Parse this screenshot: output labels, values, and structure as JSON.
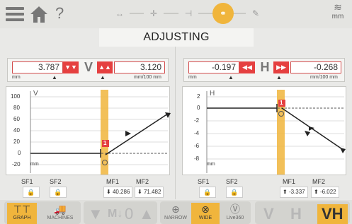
{
  "header": {
    "title": "ADJUSTING",
    "help": "?",
    "unit": "mm",
    "steps": [
      {
        "name": "measure-step-icon",
        "glyph": "↔"
      },
      {
        "name": "center-step-icon",
        "glyph": "✛"
      },
      {
        "name": "shim-step-icon",
        "glyph": "⊣"
      },
      {
        "name": "adjust-step-icon",
        "glyph": "⚭"
      },
      {
        "name": "report-step-icon",
        "glyph": "✎"
      }
    ]
  },
  "vertical": {
    "axis": "V",
    "offset": "3.787",
    "offset_unit": "mm",
    "angle": "3.120",
    "angle_unit": "mm/100 mm",
    "graph_label": "V",
    "y_ticks": [
      "100",
      "80",
      "60",
      "40",
      "20",
      "0",
      "-20"
    ],
    "unit_label": "mm",
    "coupling_marker": "1",
    "sf1": "SF1",
    "sf2": "SF2",
    "mf1_label": "MF1",
    "mf2_label": "MF2",
    "mf1": "40.286",
    "mf2": "71.482"
  },
  "horizontal": {
    "axis": "H",
    "offset": "-0.197",
    "offset_unit": "mm",
    "angle": "-0.268",
    "angle_unit": "mm/100 mm",
    "graph_label": "H",
    "y_ticks": [
      "2",
      "0",
      "-2",
      "-4",
      "-6",
      "-8"
    ],
    "unit_label": "mm",
    "coupling_marker": "1",
    "sf1": "SF1",
    "sf2": "SF2",
    "mf1_label": "MF1",
    "mf2_label": "MF2",
    "mf1": "-3.337",
    "mf2": "-6.022"
  },
  "toolbar": {
    "graph": "GRAPH",
    "machines": "MACHINES",
    "narrow": "NARROW",
    "wide": "WIDE",
    "live": "Live360",
    "zero": "0",
    "v": "V",
    "h": "H",
    "vh": "VH"
  },
  "colors": {
    "accent": "#f0b53c",
    "alert": "#e54040",
    "marker": "#e54040"
  }
}
